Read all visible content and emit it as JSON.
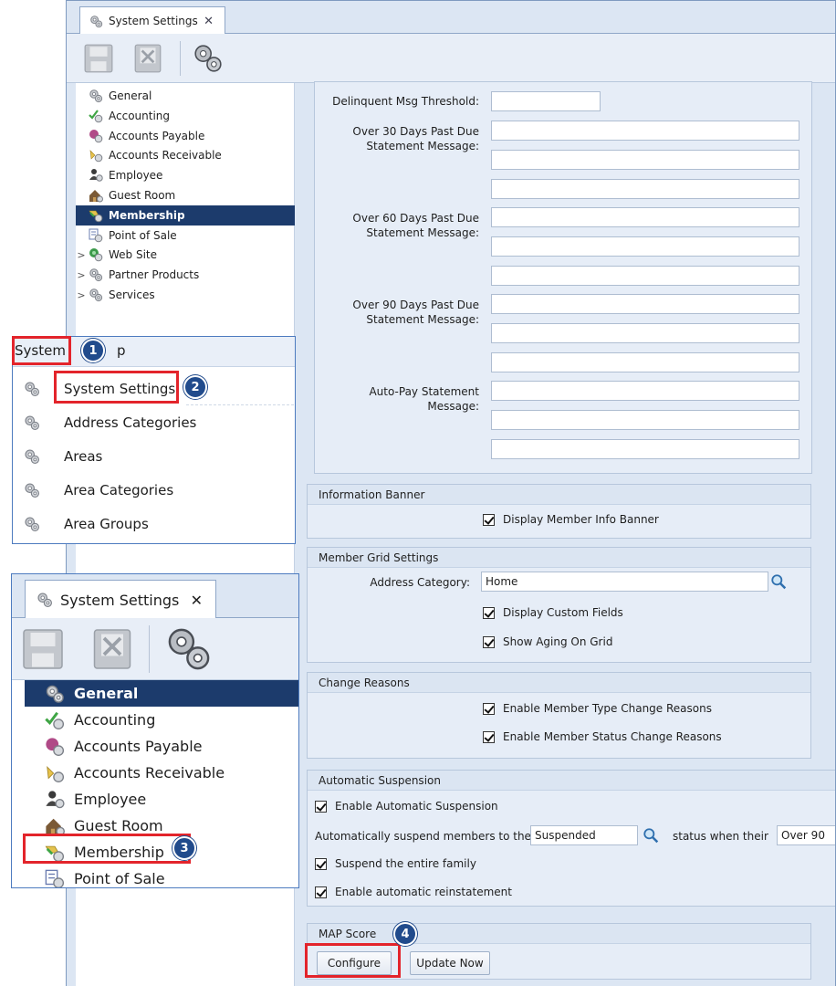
{
  "main_window": {
    "tab_title": "System Settings",
    "tab_close": "✕",
    "toolbar": {
      "save_icon": "save-icon",
      "close_icon": "close-document-icon",
      "settings_icon": "gears-icon"
    },
    "tree": [
      {
        "label": "General",
        "icon": "gear-icon"
      },
      {
        "label": "Accounting",
        "icon": "accounting-icon"
      },
      {
        "label": "Accounts Payable",
        "icon": "accounts-payable-icon"
      },
      {
        "label": "Accounts Receivable",
        "icon": "accounts-receivable-icon"
      },
      {
        "label": "Employee",
        "icon": "employee-icon"
      },
      {
        "label": "Guest Room",
        "icon": "guest-room-icon"
      },
      {
        "label": "Membership",
        "icon": "membership-icon",
        "selected": true
      },
      {
        "label": "Point of Sale",
        "icon": "point-of-sale-icon"
      },
      {
        "label": "Web Site",
        "icon": "web-site-icon",
        "expandable": true
      },
      {
        "label": "Partner Products",
        "icon": "gear-icon",
        "expandable": true
      },
      {
        "label": "Services",
        "icon": "gear-icon",
        "expandable": true
      }
    ],
    "expand_arrow": ">"
  },
  "statements": {
    "delinquent_label": "Delinquent Msg Threshold:",
    "over30_label_1": "Over 30 Days Past Due",
    "over30_label_2": "Statement Message:",
    "over60_label_1": "Over 60 Days Past Due",
    "over60_label_2": "Statement Message:",
    "over90_label_1": "Over 90 Days Past Due",
    "over90_label_2": "Statement Message:",
    "autopay_label_1": "Auto-Pay Statement",
    "autopay_label_2": "Message:"
  },
  "info_banner": {
    "header": "Information Banner",
    "display_banner": "Display Member Info Banner"
  },
  "grid_settings": {
    "header": "Member Grid Settings",
    "address_label": "Address Category:",
    "address_value": "Home",
    "display_custom": "Display Custom Fields",
    "show_aging": "Show Aging On Grid"
  },
  "change_reasons": {
    "header": "Change Reasons",
    "type_reasons": "Enable Member Type Change Reasons",
    "status_reasons": "Enable Member Status Change Reasons"
  },
  "auto_suspension": {
    "header": "Automatic Suspension",
    "enable": "Enable Automatic Suspension",
    "suspend_prefix": "Automatically suspend members to the",
    "status_value": "Suspended",
    "suspend_mid": "status when their",
    "aging_value": "Over 90",
    "entire_family": "Suspend the entire family",
    "reinstatement": "Enable automatic reinstatement"
  },
  "map_score": {
    "header": "MAP Score",
    "configure": "Configure",
    "update_now": "Update Now"
  },
  "menu_overlay": {
    "menu_system": "System",
    "menu_help_tail": "p",
    "items": [
      {
        "label": "System Settings"
      },
      {
        "label": "Address Categories"
      },
      {
        "label": "Areas"
      },
      {
        "label": "Area Categories"
      },
      {
        "label": "Area Groups"
      }
    ]
  },
  "tree_overlay": {
    "tab_title": "System Settings",
    "tab_close": "✕",
    "items": [
      {
        "label": "General",
        "selected": true
      },
      {
        "label": "Accounting"
      },
      {
        "label": "Accounts Payable"
      },
      {
        "label": "Accounts Receivable"
      },
      {
        "label": "Employee"
      },
      {
        "label": "Guest Room"
      },
      {
        "label": "Membership"
      },
      {
        "label": "Point of Sale"
      }
    ]
  },
  "callouts": {
    "step1": "1",
    "step2": "2",
    "step3": "3",
    "step4": "4"
  },
  "colors": {
    "selection": "#1c3b6c",
    "highlight": "#e3242b",
    "badge": "#214b8c"
  }
}
